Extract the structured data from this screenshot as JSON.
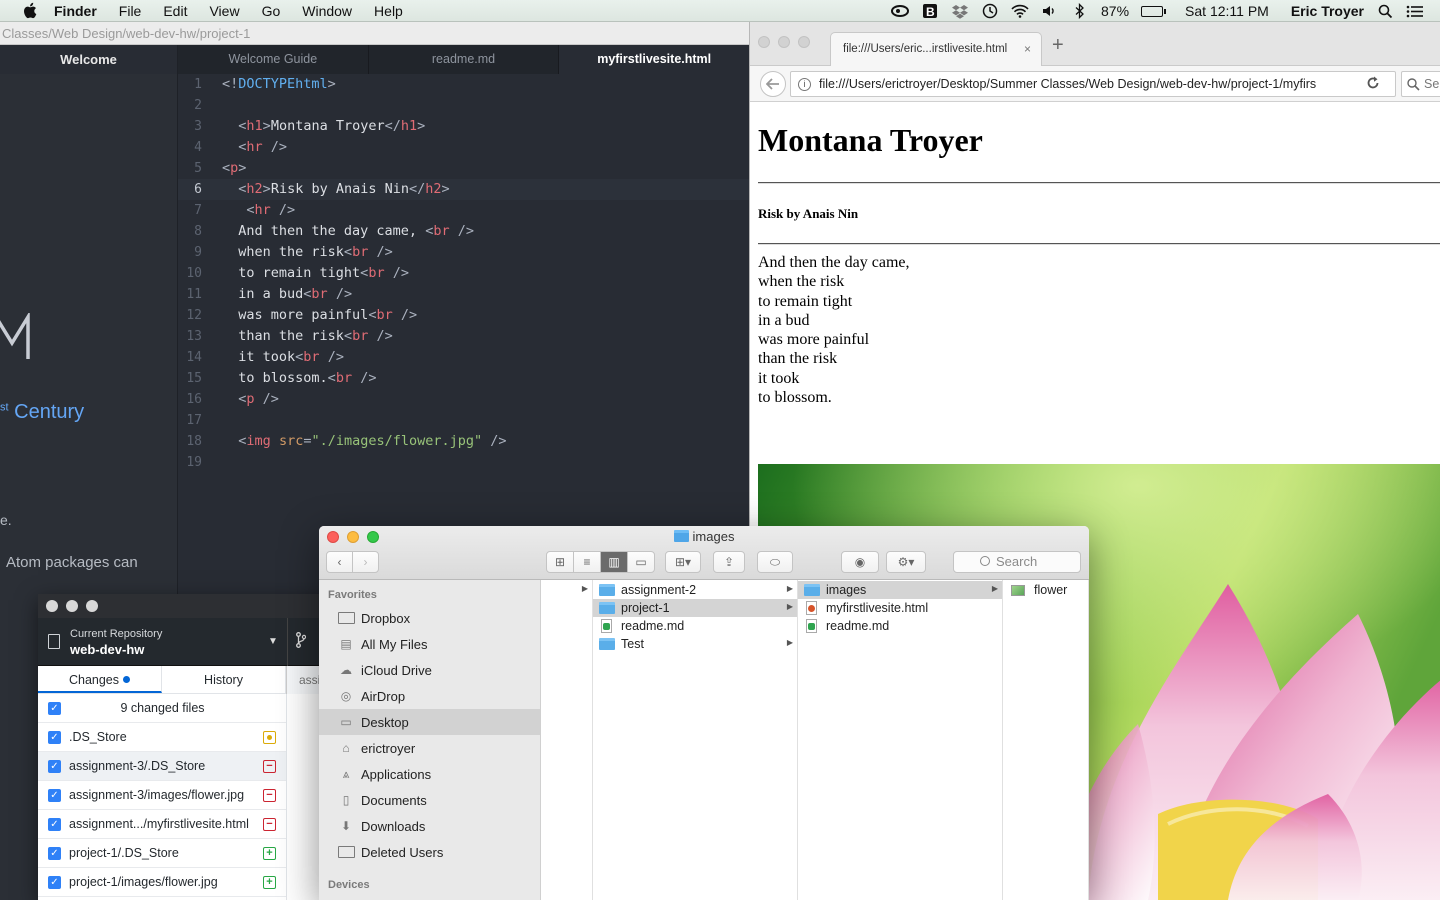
{
  "menubar": {
    "app_name": "Finder",
    "items": [
      "File",
      "Edit",
      "View",
      "Go",
      "Window",
      "Help"
    ],
    "battery_percent": "87%",
    "battery_level": 0.87,
    "clock": "Sat 12:11 PM",
    "user": "Eric Troyer"
  },
  "atom": {
    "title_path": "Classes/Web Design/web-dev-hw/project-1",
    "side_tab": "Welcome",
    "tabs": [
      "Welcome Guide",
      "readme.md",
      "myfirstlivesite.html"
    ],
    "welcome": {
      "century_sup": "st",
      "century": "Century",
      "text1": "e.",
      "text2": "Atom packages can"
    },
    "lines": [
      {
        "n": "1",
        "parts": [
          [
            "punct",
            "<!"
          ],
          [
            "doctype",
            "DOCTYPEhtml"
          ],
          [
            "punct",
            ">"
          ]
        ]
      },
      {
        "n": "2",
        "parts": []
      },
      {
        "n": "3",
        "parts": [
          [
            "txt",
            "  "
          ],
          [
            "punct",
            "<"
          ],
          [
            "tag",
            "h1"
          ],
          [
            "punct",
            ">"
          ],
          [
            "txt",
            "Montana Troyer"
          ],
          [
            "punct",
            "</"
          ],
          [
            "tag",
            "h1"
          ],
          [
            "punct",
            ">"
          ]
        ]
      },
      {
        "n": "4",
        "parts": [
          [
            "txt",
            "  "
          ],
          [
            "punct",
            "<"
          ],
          [
            "tag",
            "hr"
          ],
          [
            "punct",
            " />"
          ]
        ]
      },
      {
        "n": "5",
        "parts": [
          [
            "punct",
            "<"
          ],
          [
            "tag",
            "p"
          ],
          [
            "punct",
            ">"
          ]
        ]
      },
      {
        "n": "6",
        "parts": [
          [
            "txt",
            "  "
          ],
          [
            "punct",
            "<"
          ],
          [
            "tag",
            "h2"
          ],
          [
            "punct",
            ">"
          ],
          [
            "txt",
            "Risk by Anais Nin"
          ],
          [
            "punct",
            "</"
          ],
          [
            "tag",
            "h2"
          ],
          [
            "punct",
            ">"
          ]
        ]
      },
      {
        "n": "7",
        "parts": [
          [
            "txt",
            "   "
          ],
          [
            "punct",
            "<"
          ],
          [
            "tag",
            "hr"
          ],
          [
            "punct",
            " />"
          ]
        ]
      },
      {
        "n": "8",
        "parts": [
          [
            "txt",
            "  And then the day came, "
          ],
          [
            "punct",
            "<"
          ],
          [
            "tag",
            "br"
          ],
          [
            "punct",
            " />"
          ]
        ]
      },
      {
        "n": "9",
        "parts": [
          [
            "txt",
            "  when the risk"
          ],
          [
            "punct",
            "<"
          ],
          [
            "tag",
            "br"
          ],
          [
            "punct",
            " />"
          ]
        ]
      },
      {
        "n": "10",
        "parts": [
          [
            "txt",
            "  to remain tight"
          ],
          [
            "punct",
            "<"
          ],
          [
            "tag",
            "br"
          ],
          [
            "punct",
            " />"
          ]
        ]
      },
      {
        "n": "11",
        "parts": [
          [
            "txt",
            "  in a bud"
          ],
          [
            "punct",
            "<"
          ],
          [
            "tag",
            "br"
          ],
          [
            "punct",
            " />"
          ]
        ]
      },
      {
        "n": "12",
        "parts": [
          [
            "txt",
            "  was more painful"
          ],
          [
            "punct",
            "<"
          ],
          [
            "tag",
            "br"
          ],
          [
            "punct",
            " />"
          ]
        ]
      },
      {
        "n": "13",
        "parts": [
          [
            "txt",
            "  than the risk"
          ],
          [
            "punct",
            "<"
          ],
          [
            "tag",
            "br"
          ],
          [
            "punct",
            " />"
          ]
        ]
      },
      {
        "n": "14",
        "parts": [
          [
            "txt",
            "  it took"
          ],
          [
            "punct",
            "<"
          ],
          [
            "tag",
            "br"
          ],
          [
            "punct",
            " />"
          ]
        ]
      },
      {
        "n": "15",
        "parts": [
          [
            "txt",
            "  to blossom."
          ],
          [
            "punct",
            "<"
          ],
          [
            "tag",
            "br"
          ],
          [
            "punct",
            " />"
          ]
        ]
      },
      {
        "n": "16",
        "parts": [
          [
            "txt",
            "  "
          ],
          [
            "punct",
            "<"
          ],
          [
            "tag",
            "p"
          ],
          [
            "punct",
            " />"
          ]
        ]
      },
      {
        "n": "17",
        "parts": []
      },
      {
        "n": "18",
        "parts": [
          [
            "txt",
            "  "
          ],
          [
            "punct",
            "<"
          ],
          [
            "tag",
            "img"
          ],
          [
            "txt",
            " "
          ],
          [
            "attr",
            "src"
          ],
          [
            "punct",
            "="
          ],
          [
            "str",
            "\"./images/flower.jpg\""
          ],
          [
            "punct",
            " />"
          ]
        ]
      },
      {
        "n": "19",
        "parts": []
      }
    ],
    "cursor_line": "6"
  },
  "browser": {
    "tab_title": "file:///Users/eric...irstlivesite.html",
    "tab_close": "×",
    "new_tab": "+",
    "url": "file:///Users/erictroyer/Desktop/Summer Classes/Web Design/web-dev-hw/project-1/myfirs",
    "search_placeholder": "Se",
    "page": {
      "h1": "Montana Troyer",
      "h2": "Risk by Anais Nin",
      "poem": [
        "And then the day came,",
        "when the risk",
        "to remain tight",
        "in a bud",
        "was more painful",
        "than the risk",
        "it took",
        "to blossom."
      ]
    }
  },
  "github": {
    "repo_label": "Current Repository",
    "repo_name": "web-dev-hw",
    "tabs": [
      "Changes",
      "History"
    ],
    "tab_peek": "assi",
    "summary": "9 changed files",
    "files": [
      {
        "name": ".DS_Store",
        "status": "modified"
      },
      {
        "name": "assignment-3/.DS_Store",
        "status": "deleted"
      },
      {
        "name": "assignment-3/images/flower.jpg",
        "status": "deleted"
      },
      {
        "name": "assignment.../myfirstlivesite.html",
        "status": "deleted"
      },
      {
        "name": "project-1/.DS_Store",
        "status": "added"
      },
      {
        "name": "project-1/images/flower.jpg",
        "status": "added"
      }
    ]
  },
  "finder": {
    "title": "images",
    "search_placeholder": "Search",
    "sidebar_heading": "Favorites",
    "sidebar_items": [
      {
        "label": "Dropbox",
        "icon": "dropbox-folder-icon"
      },
      {
        "label": "All My Files",
        "icon": "all-files-icon"
      },
      {
        "label": "iCloud Drive",
        "icon": "cloud-icon"
      },
      {
        "label": "AirDrop",
        "icon": "airdrop-icon"
      },
      {
        "label": "Desktop",
        "icon": "desktop-icon"
      },
      {
        "label": "erictroyer",
        "icon": "home-icon"
      },
      {
        "label": "Applications",
        "icon": "applications-icon"
      },
      {
        "label": "Documents",
        "icon": "documents-icon"
      },
      {
        "label": "Downloads",
        "icon": "downloads-icon"
      },
      {
        "label": "Deleted Users",
        "icon": "folder-icon"
      }
    ],
    "devices_heading": "Devices",
    "col2": [
      {
        "name": "assignment-2",
        "type": "folder",
        "arrow": true
      },
      {
        "name": "project-1",
        "type": "folder",
        "arrow": true,
        "selected": true
      },
      {
        "name": "readme.md",
        "type": "md"
      },
      {
        "name": "Test",
        "type": "folder",
        "arrow": true
      }
    ],
    "col3": [
      {
        "name": "images",
        "type": "folder",
        "arrow": true,
        "selected": true
      },
      {
        "name": "myfirstlivesite.html",
        "type": "html"
      },
      {
        "name": "readme.md",
        "type": "md"
      }
    ],
    "col4": [
      {
        "name": "flower",
        "type": "image"
      }
    ]
  }
}
